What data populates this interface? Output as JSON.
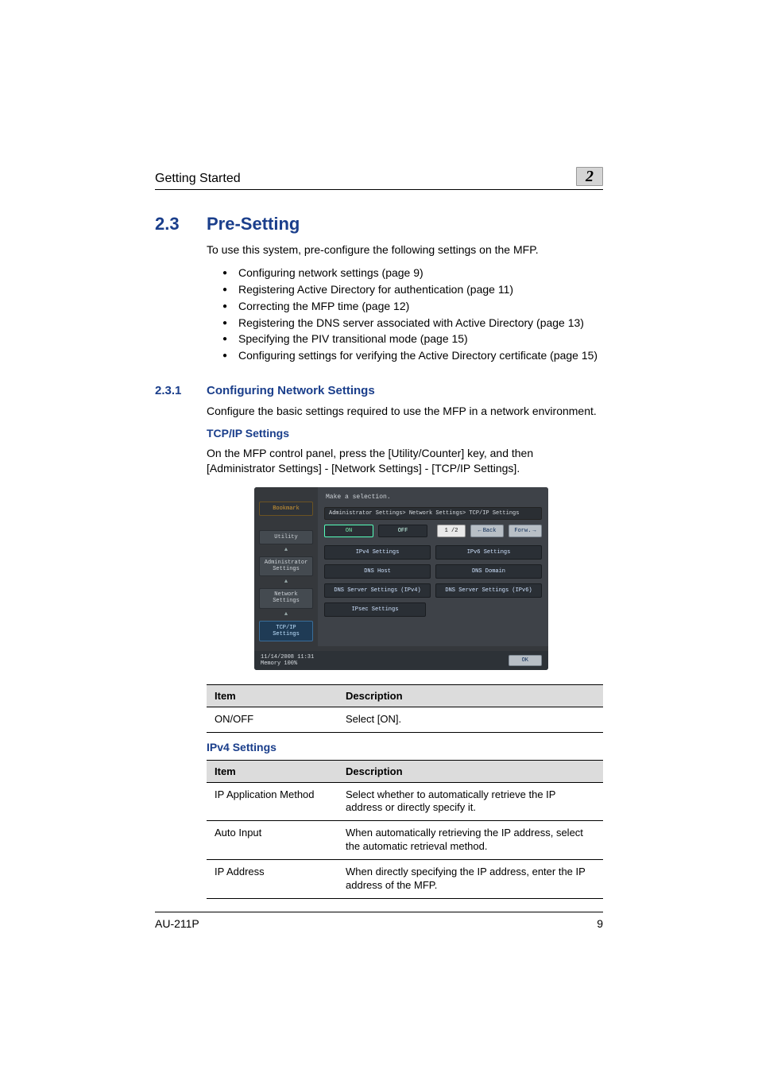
{
  "header": {
    "running_title": "Getting Started",
    "chapter_number": "2"
  },
  "section": {
    "number": "2.3",
    "title": "Pre-Setting",
    "intro": "To use this system, pre-configure the following settings on the MFP.",
    "bullets": [
      "Configuring network settings (page 9)",
      "Registering Active Directory for authentication (page 11)",
      "Correcting the MFP time (page 12)",
      "Registering the DNS server associated with Active Directory (page 13)",
      "Specifying the PIV transitional mode (page 15)",
      "Configuring settings for verifying the Active Directory certificate (page 15)"
    ]
  },
  "subsection": {
    "number": "2.3.1",
    "title": "Configuring Network Settings",
    "para": "Configure the basic settings required to use the MFP in a network environment.",
    "tcpip_heading": "TCP/IP Settings",
    "tcpip_para": "On the MFP control panel, press the [Utility/Counter] key, and then [Administrator Settings] - [Network Settings] - [TCP/IP Settings]."
  },
  "panel": {
    "instruction": "Make a selection.",
    "breadcrumb": "Administrator Settings> Network Settings> TCP/IP Settings",
    "on_label": "ON",
    "off_label": "OFF",
    "page_indicator": "1 /2",
    "back_label": "Back",
    "forward_label": "Forw.",
    "tiles": {
      "ipv4": "IPv4 Settings",
      "ipv6": "IPv6 Settings",
      "dns_host": "DNS Host",
      "dns_domain": "DNS Domain",
      "dns_srv_v4": "DNS Server Settings (IPv4)",
      "dns_srv_v6": "DNS Server Settings (IPv6)",
      "ipsec": "IPsec Settings"
    },
    "sidebar": {
      "bookmark": "Bookmark",
      "utility": "Utility",
      "admin": "Administrator Settings",
      "network": "Network Settings",
      "tcpip": "TCP/IP Settings"
    },
    "footer": {
      "datetime": "11/14/2008   11:31",
      "memory": "Memory      100%",
      "ok": "OK"
    }
  },
  "table1": {
    "heading": "",
    "headers": {
      "item": "Item",
      "desc": "Description"
    },
    "rows": [
      {
        "item": "ON/OFF",
        "desc": "Select [ON]."
      }
    ]
  },
  "ipv4_heading": "IPv4 Settings",
  "table2": {
    "headers": {
      "item": "Item",
      "desc": "Description"
    },
    "rows": [
      {
        "item": "IP Application Method",
        "desc": "Select whether to automatically retrieve the IP address or directly specify it."
      },
      {
        "item": "Auto Input",
        "desc": "When automatically retrieving the IP address, select the automatic retrieval method."
      },
      {
        "item": "IP Address",
        "desc": "When directly specifying the IP address, enter the IP address of the MFP."
      }
    ]
  },
  "footer": {
    "model": "AU-211P",
    "page": "9"
  }
}
